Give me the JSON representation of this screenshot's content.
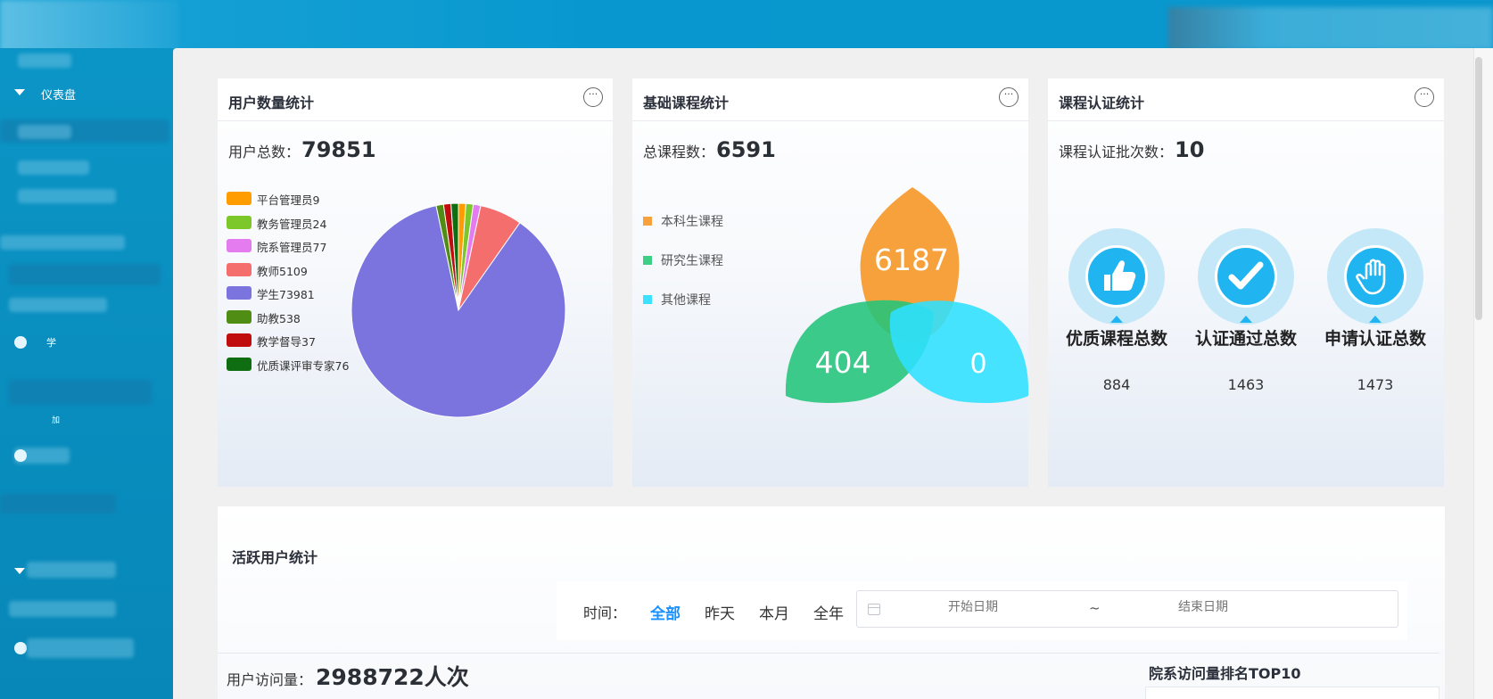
{
  "sidebar": {
    "dashboard_label": "仪表盘",
    "item_student_label": "学",
    "item_small_label": "加"
  },
  "cards": {
    "users": {
      "title": "用户数量统计",
      "total_label": "用户总数：",
      "total_value": "79851",
      "legend": [
        {
          "label": "平台管理员9",
          "color": "#ff9c00"
        },
        {
          "label": "教务管理员24",
          "color": "#7cc72a"
        },
        {
          "label": "院系管理员77",
          "color": "#e47cf0"
        },
        {
          "label": "教师5109",
          "color": "#f56e6e"
        },
        {
          "label": "学生73981",
          "color": "#7b74de"
        },
        {
          "label": "助教538",
          "color": "#4f8d14"
        },
        {
          "label": "教学督导37",
          "color": "#c00e0e"
        },
        {
          "label": "优质课评审专家76",
          "color": "#0f6e12"
        }
      ]
    },
    "courses": {
      "title": "基础课程统计",
      "total_label": "总课程数：",
      "total_value": "6591",
      "legend": [
        {
          "label": "本科生课程",
          "color": "#f7a13c"
        },
        {
          "label": "研究生课程",
          "color": "#3dcf86"
        },
        {
          "label": "其他课程",
          "color": "#3be2ff"
        }
      ],
      "values": {
        "undergrad": "6187",
        "grad": "404",
        "other": "0"
      }
    },
    "cert": {
      "title": "课程认证统计",
      "total_label": "课程认证批次数：",
      "total_value": "10",
      "items": [
        {
          "label": "优质课程总数",
          "value": "884",
          "icon": "thumbs-up-icon"
        },
        {
          "label": "认证通过总数",
          "value": "1463",
          "icon": "checkmark-icon"
        },
        {
          "label": "申请认证总数",
          "value": "1473",
          "icon": "hand-icon"
        }
      ]
    }
  },
  "user_pie": {
    "type": "pie",
    "categories": [
      "平台管理员",
      "教务管理员",
      "院系管理员",
      "教师",
      "学生",
      "助教",
      "教学督导",
      "优质课评审专家"
    ],
    "values": [
      9,
      24,
      77,
      5109,
      73981,
      538,
      37,
      76
    ],
    "colors": [
      "#ff9c00",
      "#7cc72a",
      "#e47cf0",
      "#f56e6e",
      "#7b74de",
      "#4f8d14",
      "#c00e0e",
      "#0f6e12"
    ]
  },
  "active": {
    "title": "活跃用户统计",
    "filter_label": "时间：",
    "options": [
      "全部",
      "昨天",
      "本月",
      "全年"
    ],
    "start_placeholder": "开始日期",
    "end_placeholder": "结束日期",
    "date_sep": "~",
    "visits_label": "用户访问量：",
    "visits_value": "2988722人次",
    "rank_title": "院系访问量排名TOP10"
  },
  "more_label": "···"
}
